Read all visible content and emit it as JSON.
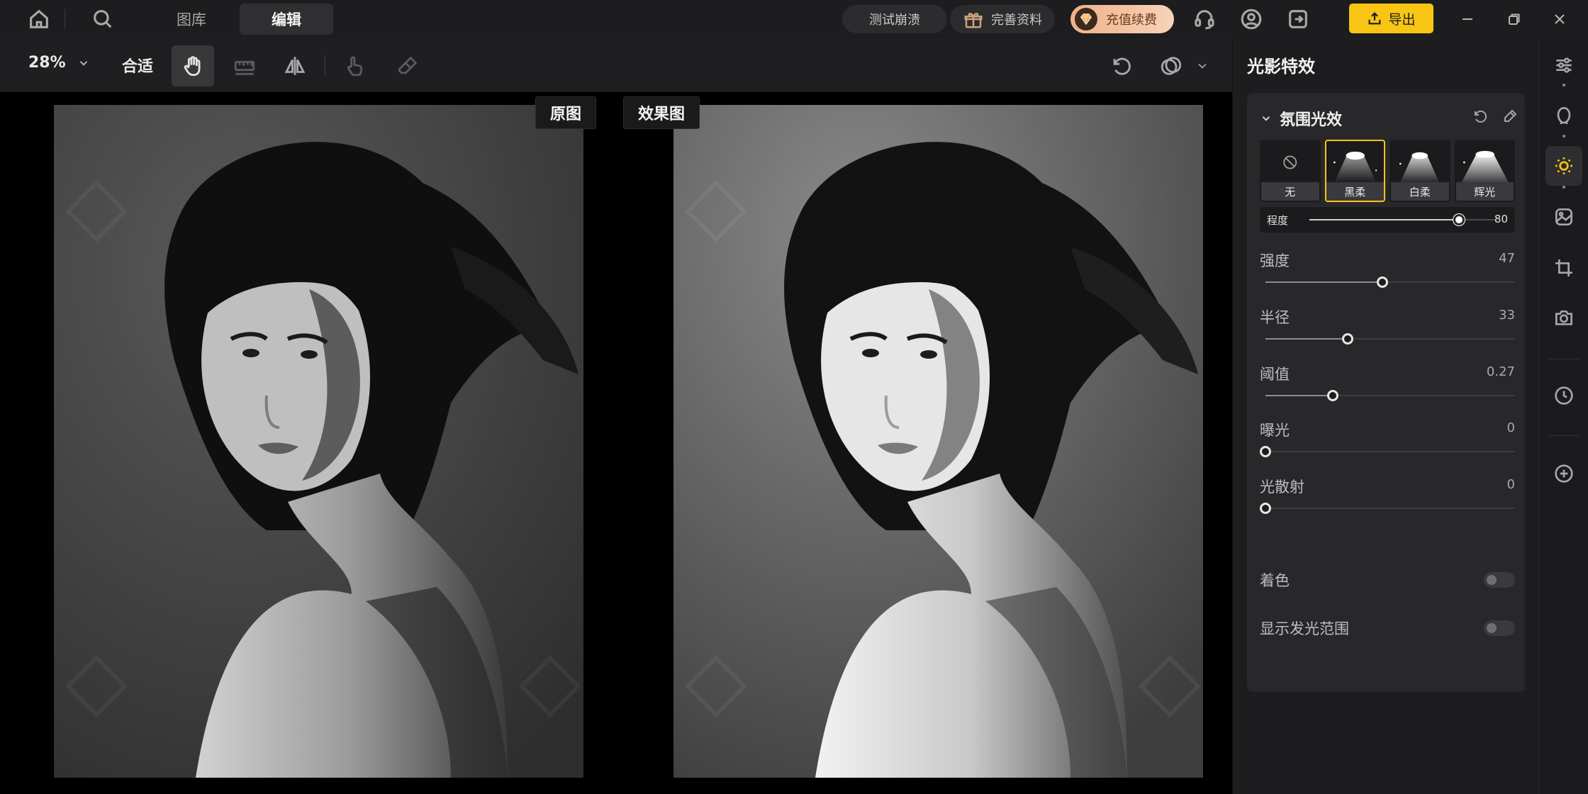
{
  "nav": {
    "tab_library": "图库",
    "tab_edit": "编辑",
    "test_crash": "测试崩溃",
    "complete_profile": "完善资料",
    "recharge": "充值续费",
    "export": "导出"
  },
  "toolbar": {
    "zoom": "28%",
    "fit": "合适"
  },
  "canvas": {
    "original_label": "原图",
    "effect_label": "效果图"
  },
  "panel": {
    "title": "光影特效",
    "section_title": "氛围光效",
    "presets": [
      {
        "label": "无",
        "selected": false
      },
      {
        "label": "黑柔",
        "selected": true
      },
      {
        "label": "白柔",
        "selected": false
      },
      {
        "label": "辉光",
        "selected": false
      }
    ],
    "degree": {
      "label": "程度",
      "value": "80",
      "fraction": 0.8
    },
    "sliders": [
      {
        "label": "强度",
        "value": "47",
        "fraction": 0.47
      },
      {
        "label": "半径",
        "value": "33",
        "fraction": 0.33
      },
      {
        "label": "阈值",
        "value": "0.27",
        "fraction": 0.27
      },
      {
        "label": "曝光",
        "value": "0",
        "fraction": 0
      },
      {
        "label": "光散射",
        "value": "0",
        "fraction": 0
      }
    ],
    "toggles": [
      {
        "label": "着色",
        "on": false
      },
      {
        "label": "显示发光范围",
        "on": false
      }
    ]
  },
  "colors": {
    "accent": "#f8c514",
    "recharge_start": "#f0b188",
    "recharge_end": "#f7d3b8"
  },
  "icons": {
    "titlebar": [
      "home-icon",
      "search-icon",
      "gift-icon",
      "gem-icon",
      "headset-icon",
      "user-icon",
      "logout-icon",
      "upload-icon",
      "minimize-icon",
      "restore-icon",
      "close-icon"
    ],
    "toolbar": [
      "chevron-down-icon",
      "hand-icon",
      "ruler-icon",
      "flip-icon",
      "hand-pointer-icon",
      "eraser-icon",
      "undo-icon",
      "compare-icon",
      "chevron-down-icon"
    ],
    "rail": [
      "adjust-icon",
      "face-icon",
      "sun-icon",
      "image-edit-icon",
      "crop-icon",
      "camera-icon",
      "history-icon",
      "plus-icon"
    ]
  }
}
